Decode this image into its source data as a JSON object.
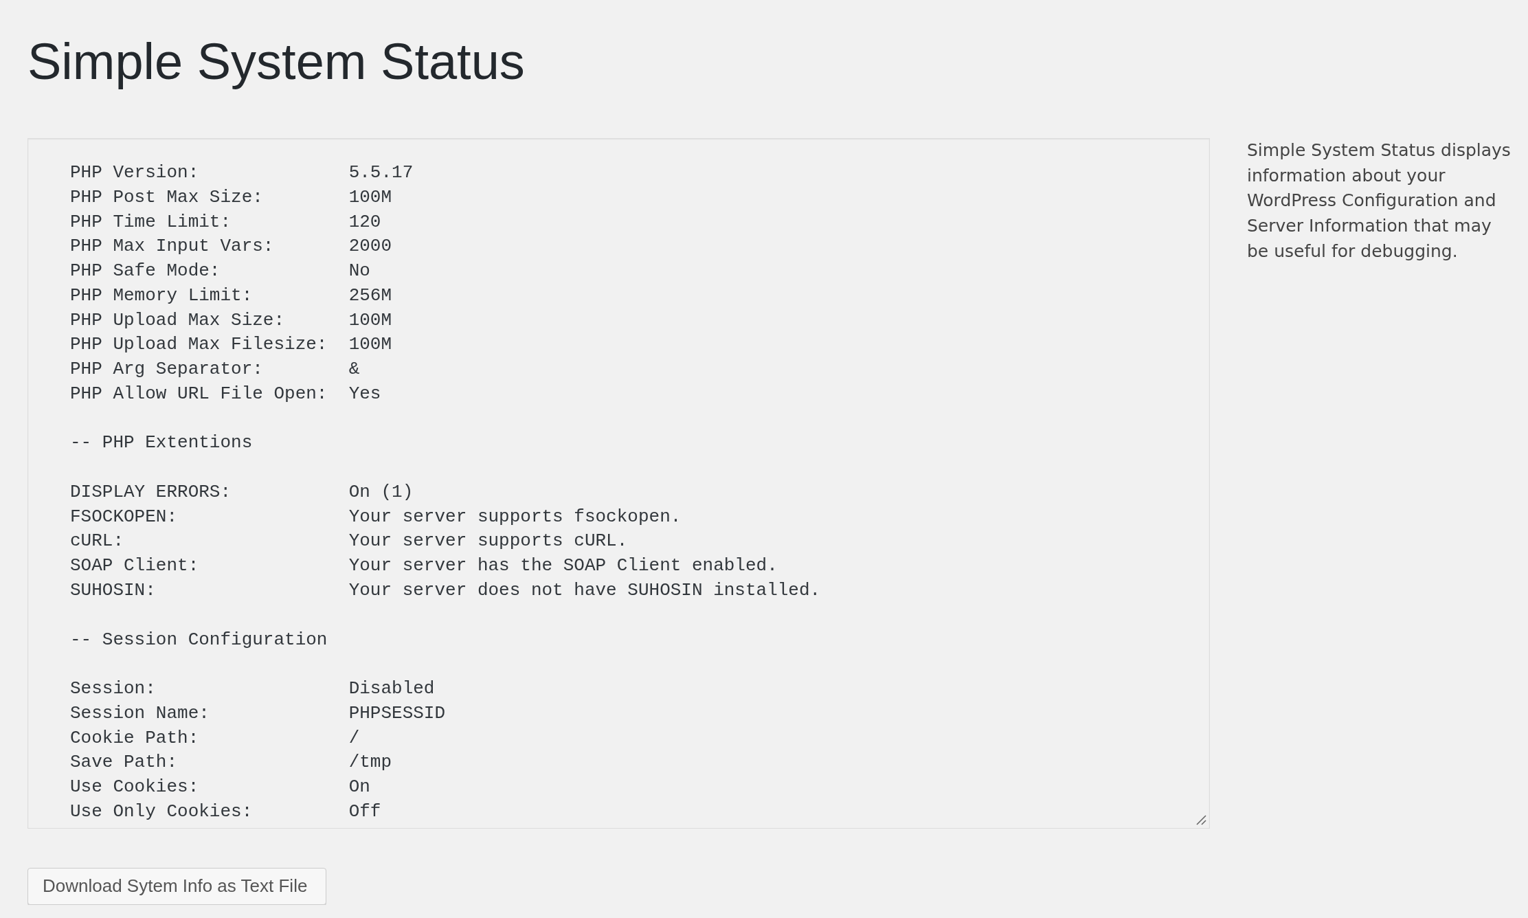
{
  "page": {
    "title": "Simple System Status"
  },
  "system_info": {
    "sections": [
      {
        "rows": [
          {
            "label": "PHP Version:",
            "value": "5.5.17"
          },
          {
            "label": "PHP Post Max Size:",
            "value": "100M"
          },
          {
            "label": "PHP Time Limit:",
            "value": "120"
          },
          {
            "label": "PHP Max Input Vars:",
            "value": "2000"
          },
          {
            "label": "PHP Safe Mode:",
            "value": "No"
          },
          {
            "label": "PHP Memory Limit:",
            "value": "256M"
          },
          {
            "label": "PHP Upload Max Size:",
            "value": "100M"
          },
          {
            "label": "PHP Upload Max Filesize:",
            "value": "100M"
          },
          {
            "label": "PHP Arg Separator:",
            "value": "&"
          },
          {
            "label": "PHP Allow URL File Open:",
            "value": "Yes"
          }
        ]
      },
      {
        "heading": "-- PHP Extentions",
        "rows": [
          {
            "label": "DISPLAY ERRORS:",
            "value": "On (1)"
          },
          {
            "label": "FSOCKOPEN:",
            "value": "Your server supports fsockopen."
          },
          {
            "label": "cURL:",
            "value": "Your server supports cURL."
          },
          {
            "label": "SOAP Client:",
            "value": "Your server has the SOAP Client enabled."
          },
          {
            "label": "SUHOSIN:",
            "value": "Your server does not have SUHOSIN installed."
          }
        ]
      },
      {
        "heading": "-- Session Configuration",
        "rows": [
          {
            "label": "Session:",
            "value": "Disabled"
          },
          {
            "label": "Session Name:",
            "value": "PHPSESSID"
          },
          {
            "label": "Cookie Path:",
            "value": "/"
          },
          {
            "label": "Save Path:",
            "value": "/tmp"
          },
          {
            "label": "Use Cookies:",
            "value": "On"
          },
          {
            "label": "Use Only Cookies:",
            "value": "Off"
          }
        ]
      }
    ]
  },
  "sidebar": {
    "description": "Simple System Status displays information about your WordPress Configuration and Server Information that may be useful for debugging."
  },
  "buttons": [
    {
      "label": "Download Sytem Info as Text File"
    }
  ]
}
